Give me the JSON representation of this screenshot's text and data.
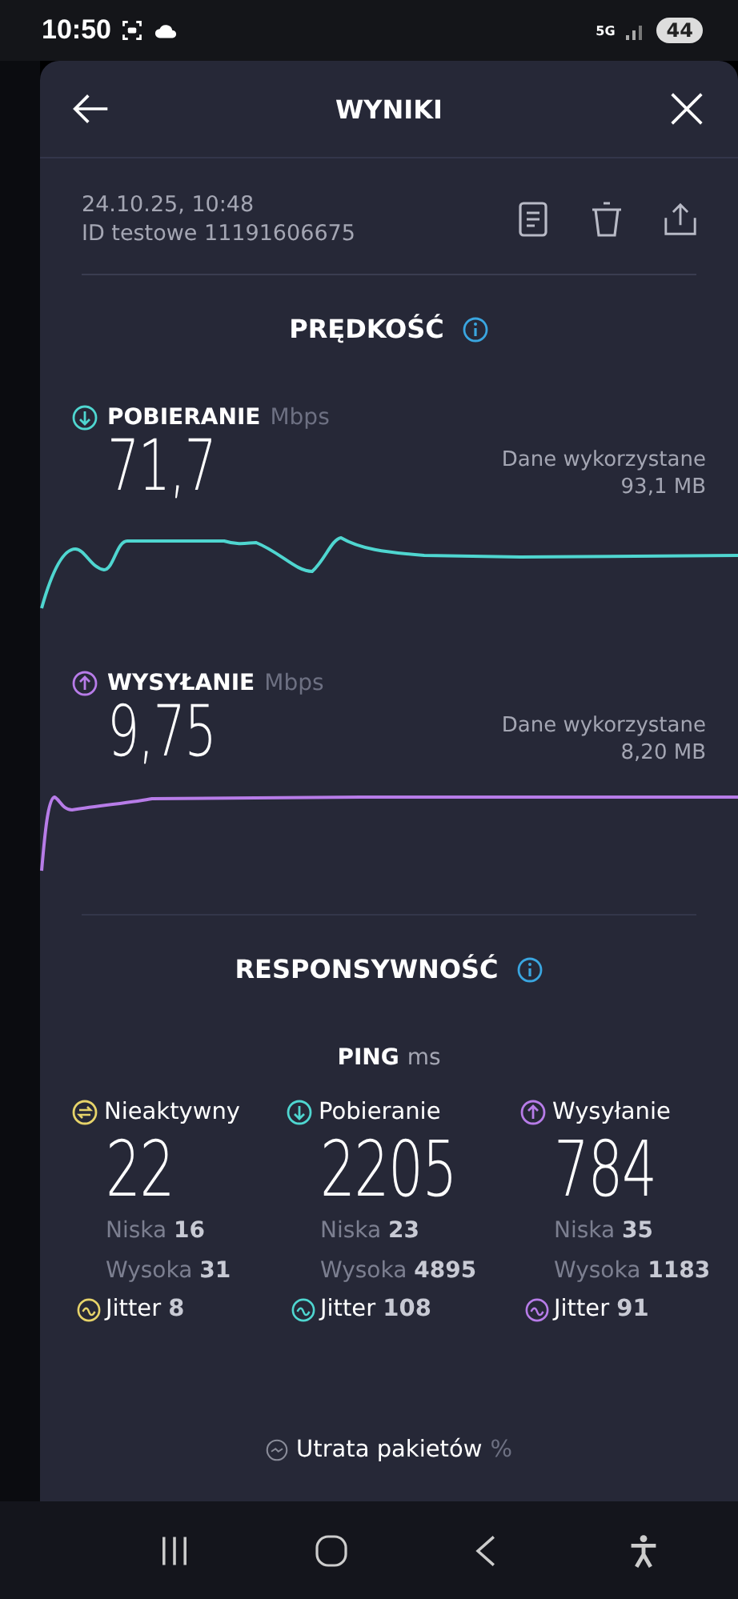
{
  "status_bar": {
    "time": "10:50",
    "network": "5G",
    "battery": "44"
  },
  "header": {
    "title": "WYNIKI"
  },
  "test": {
    "date": "24.10.25, 10:48",
    "id": "ID testowe 11191606675"
  },
  "speed": {
    "title": "PRĘDKOŚĆ",
    "metrics": [
      {
        "kind": "download",
        "label": "POBIERANIE",
        "unit": "Mbps",
        "value": "71,7",
        "data_label": "Dane wykorzystane",
        "data_value": "93,1 MB",
        "color": "#4fd6d0"
      },
      {
        "kind": "upload",
        "label": "WYSYŁANIE",
        "unit": "Mbps",
        "value": "9,75",
        "data_label": "Dane wykorzystane",
        "data_value": "8,20 MB",
        "color": "#b77ce8"
      }
    ]
  },
  "responsiveness": {
    "title": "RESPONSYWNOŚĆ",
    "ping_label": "PING",
    "ping_unit": "ms",
    "columns": [
      {
        "kind": "idle",
        "label": "Nieaktywny",
        "value": "22",
        "low_label": "Niska",
        "low": "16",
        "high_label": "Wysoka",
        "high": "31",
        "jitter_label": "Jitter",
        "jitter": "8",
        "color": "#e6d36a"
      },
      {
        "kind": "download",
        "label": "Pobieranie",
        "value": "2205",
        "low_label": "Niska",
        "low": "23",
        "high_label": "Wysoka",
        "high": "4895",
        "jitter_label": "Jitter",
        "jitter": "108",
        "color": "#4fd6d0"
      },
      {
        "kind": "upload",
        "label": "Wysyłanie",
        "value": "784",
        "low_label": "Niska",
        "low": "35",
        "high_label": "Wysoka",
        "high": "1183",
        "jitter_label": "Jitter",
        "jitter": "91",
        "color": "#b77ce8"
      }
    ]
  },
  "packet_loss": {
    "label": "Utrata pakietów",
    "unit": "%"
  }
}
